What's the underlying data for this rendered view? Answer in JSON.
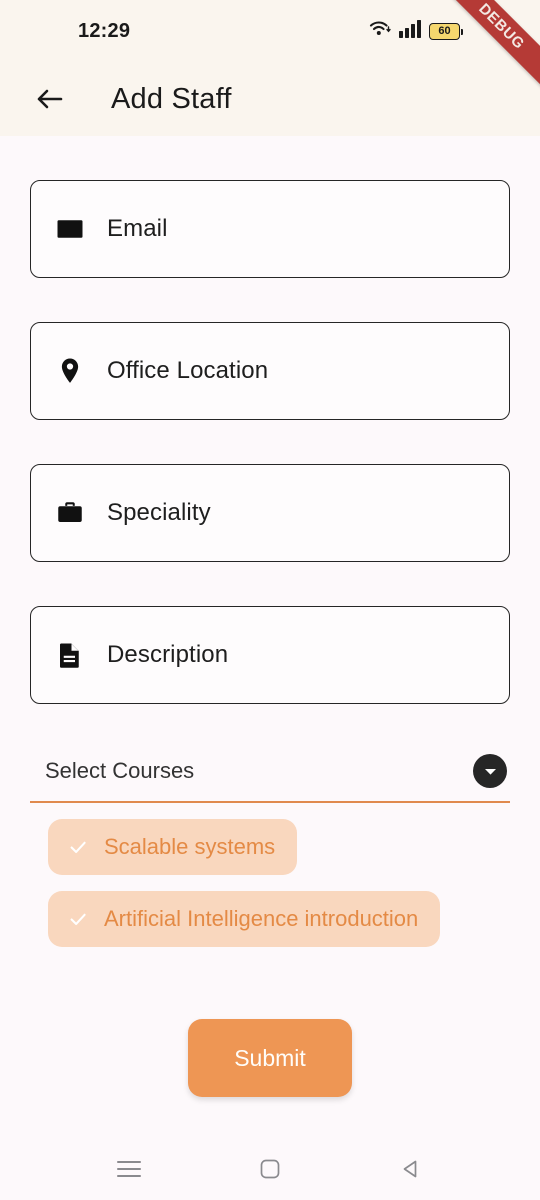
{
  "status_bar": {
    "time": "12:29",
    "wifi_icon": "wifi-icon",
    "signal_icon": "cellular-signal-icon",
    "battery_level": "60",
    "debug_ribbon": "DEBUG"
  },
  "appbar": {
    "back_icon": "back-arrow-icon",
    "title": "Add Staff"
  },
  "form": {
    "fields": [
      {
        "label": "Email",
        "icon": "envelope-icon",
        "placeholder": "Email"
      },
      {
        "label": "Office Location",
        "icon": "map-pin-icon",
        "placeholder": "Office Location"
      },
      {
        "label": "Speciality",
        "icon": "briefcase-icon",
        "placeholder": "Speciality"
      },
      {
        "label": "Description",
        "icon": "document-icon",
        "placeholder": "Description"
      }
    ]
  },
  "courses": {
    "dropdown_label": "Select Courses",
    "dropdown_icon": "chevron-down-icon",
    "selected": [
      {
        "label": "Scalable systems",
        "icon": "check-icon"
      },
      {
        "label": "Artificial Intelligence introduction",
        "icon": "check-icon"
      }
    ]
  },
  "submit": {
    "label": "Submit"
  },
  "navbar": {
    "recents_icon": "recents-icon",
    "home_icon": "home-icon",
    "back_icon": "nav-back-icon"
  },
  "colors": {
    "header_bg": "#FAF5EE",
    "page_bg": "#FDF9FB",
    "accent_orange": "#EE9654",
    "underline_orange": "#E08A4E",
    "chip_bg": "#F9D7BE",
    "chip_text": "#E48A45",
    "debug_red": "#B53A36",
    "battery_yellow": "#F5D76E"
  }
}
